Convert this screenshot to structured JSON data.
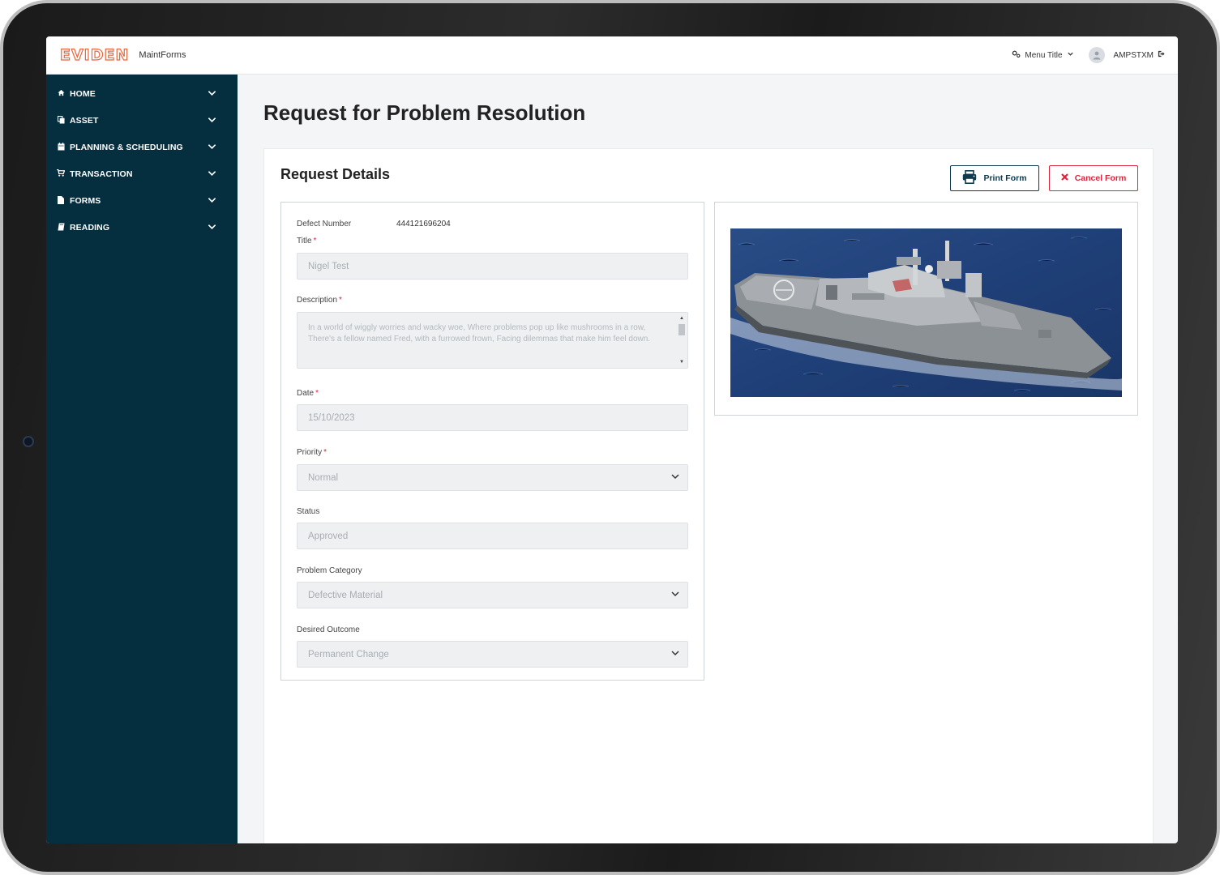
{
  "header": {
    "logo": "EVIDEN",
    "app_name": "MaintForms",
    "menu_title": "Menu Title",
    "username": "AMPSTXM"
  },
  "sidebar": {
    "items": [
      {
        "label": "HOME",
        "icon": "home-icon"
      },
      {
        "label": "ASSET",
        "icon": "copy-icon"
      },
      {
        "label": "PLANNING & SCHEDULING",
        "icon": "calendar-icon"
      },
      {
        "label": "TRANSACTION",
        "icon": "cart-icon"
      },
      {
        "label": "FORMS",
        "icon": "file-icon"
      },
      {
        "label": "READING",
        "icon": "book-icon"
      }
    ]
  },
  "page": {
    "title": "Request for Problem Resolution"
  },
  "card": {
    "title": "Request Details",
    "print_label": "Print Form",
    "cancel_label": "Cancel Form"
  },
  "form": {
    "defect_number_label": "Defect Number",
    "defect_number_value": "444121696204",
    "title_label": "Title",
    "title_value": "Nigel Test",
    "description_label": "Description",
    "description_value": "In a world of wiggly worries and wacky woe, Where problems pop up like mushrooms in a row, There's a fellow named Fred, with a furrowed frown, Facing dilemmas that make him feel down.",
    "date_label": "Date",
    "date_value": "15/10/2023",
    "priority_label": "Priority",
    "priority_value": "Normal",
    "status_label": "Status",
    "status_value": "Approved",
    "problem_category_label": "Problem Category",
    "problem_category_value": "Defective Material",
    "desired_outcome_label": "Desired Outcome",
    "desired_outcome_value": "Permanent Change"
  },
  "colors": {
    "sidebar_bg": "#052e3f",
    "brand_orange": "#e8673c",
    "danger": "#d7263d",
    "print_border": "#0f3a4d"
  }
}
